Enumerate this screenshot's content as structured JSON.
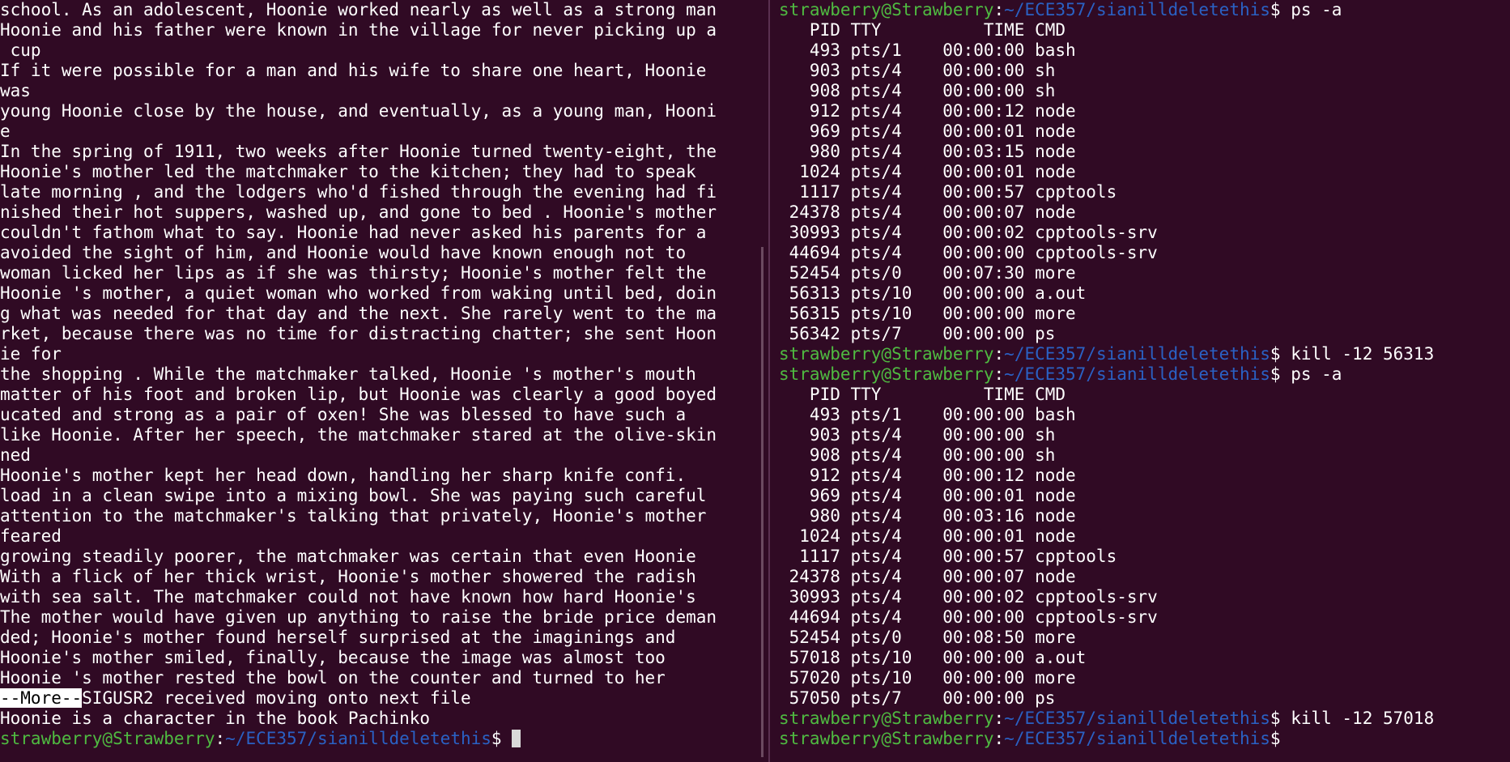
{
  "left": {
    "text_lines": [
      "school. As an adolescent, Hoonie worked nearly as well as a strong man",
      "Hoonie and his father were known in the village for never picking up a",
      " cup",
      "If it were possible for a man and his wife to share one heart, Hoonie",
      "was",
      "young Hoonie close by the house, and eventually, as a young man, Hooni",
      "e",
      "In the spring of 1911, two weeks after Hoonie turned twenty-eight, the",
      "Hoonie's mother led the matchmaker to the kitchen; they had to speak",
      "late morning , and the lodgers who'd fished through the evening had fi",
      "nished their hot suppers, washed up, and gone to bed . Hoonie's mother",
      "couldn't fathom what to say. Hoonie had never asked his parents for a",
      "avoided the sight of him, and Hoonie would have known enough not to",
      "woman licked her lips as if she was thirsty; Hoonie's mother felt the",
      "Hoonie 's mother, a quiet woman who worked from waking until bed, doin",
      "g what was needed for that day and the next. She rarely went to the ma",
      "rket, because there was no time for distracting chatter; she sent Hoon",
      "ie for",
      "the shopping . While the matchmaker talked, Hoonie 's mother's mouth",
      "matter of his foot and broken lip, but Hoonie was clearly a good boyed",
      "ucated and strong as a pair of oxen! She was blessed to have such a",
      "like Hoonie. After her speech, the matchmaker stared at the olive-skin",
      "ned",
      "Hoonie's mother kept her head down, handling her sharp knife confi.",
      "load in a clean swipe into a mixing bowl. She was paying such careful",
      "attention to the matchmaker's talking that privately, Hoonie's mother",
      "feared",
      "growing steadily poorer, the matchmaker was certain that even Hoonie",
      "With a flick of her thick wrist, Hoonie's mother showered the radish",
      "with sea salt. The matchmaker could not have known how hard Hoonie's",
      "The mother would have given up anything to raise the bride price deman",
      "ded; Hoonie's mother found herself surprised at the imaginings and",
      "Hoonie's mother smiled, finally, because the image was almost too",
      "Hoonie 's mother rested the bowl on the counter and turned to her"
    ],
    "more_prompt": "--More--",
    "signal_message": "SIGUSR2 received moving onto next file",
    "last_output": "Hoonie is a character in the book Pachinko",
    "prompt": {
      "user": "strawberry@Strawberry",
      "sep": ":",
      "path": "~/ECE357/sianilldeletethis",
      "symbol": "$ "
    }
  },
  "right": {
    "prompt": {
      "user": "strawberry@Strawberry",
      "sep": ":",
      "path": "~/ECE357/sianilldeletethis",
      "symbol": "$ "
    },
    "ps_header": "   PID TTY          TIME CMD",
    "cmd1": "ps -a",
    "ps1_rows": [
      "   493 pts/1    00:00:00 bash",
      "   903 pts/4    00:00:00 sh",
      "   908 pts/4    00:00:00 sh",
      "   912 pts/4    00:00:12 node",
      "   969 pts/4    00:00:01 node",
      "   980 pts/4    00:03:15 node",
      "  1024 pts/4    00:00:01 node",
      "  1117 pts/4    00:00:57 cpptools",
      " 24378 pts/4    00:00:07 node",
      " 30993 pts/4    00:00:02 cpptools-srv",
      " 44694 pts/4    00:00:00 cpptools-srv",
      " 52454 pts/0    00:07:30 more",
      " 56313 pts/10   00:00:00 a.out",
      " 56315 pts/10   00:00:00 more",
      " 56342 pts/7    00:00:00 ps"
    ],
    "cmd2": "kill -12 56313",
    "cmd3": "ps -a",
    "ps2_rows": [
      "   493 pts/1    00:00:00 bash",
      "   903 pts/4    00:00:00 sh",
      "   908 pts/4    00:00:00 sh",
      "   912 pts/4    00:00:12 node",
      "   969 pts/4    00:00:01 node",
      "   980 pts/4    00:03:16 node",
      "  1024 pts/4    00:00:01 node",
      "  1117 pts/4    00:00:57 cpptools",
      " 24378 pts/4    00:00:07 node",
      " 30993 pts/4    00:00:02 cpptools-srv",
      " 44694 pts/4    00:00:00 cpptools-srv",
      " 52454 pts/0    00:08:50 more",
      " 57018 pts/10   00:00:00 a.out",
      " 57020 pts/10   00:00:00 more",
      " 57050 pts/7    00:00:00 ps"
    ],
    "cmd4": "kill -12 57018"
  },
  "colors": {
    "background": "#300a24",
    "user": "#4fba41",
    "path": "#2a61c4",
    "text": "#ffffff"
  }
}
